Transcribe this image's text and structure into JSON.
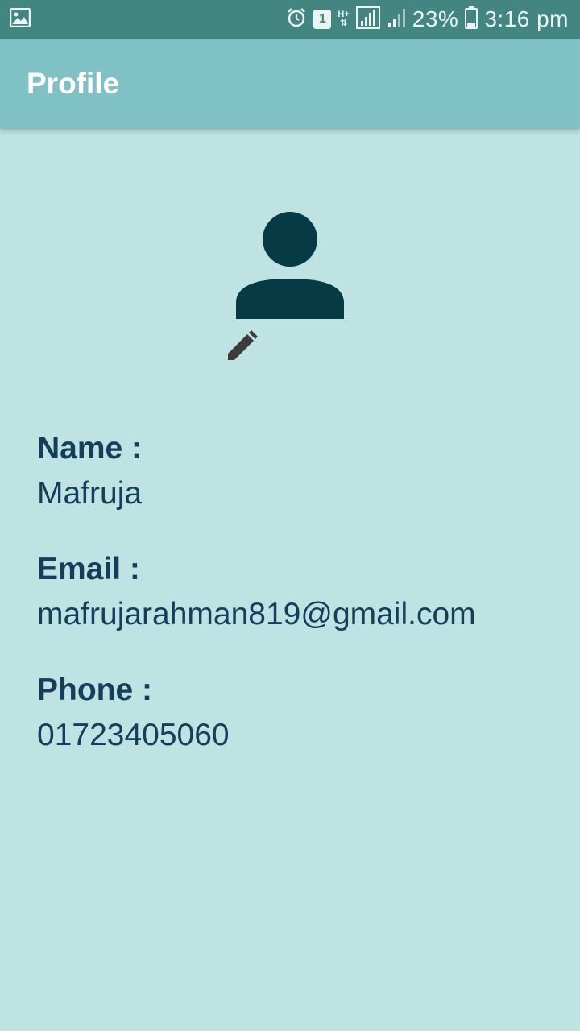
{
  "status_bar": {
    "sim_slot": "1",
    "network_type": "H+",
    "battery_percent": "23%",
    "time": "3:16 pm",
    "icons": [
      "gallery-icon",
      "alarm-icon",
      "sim-icon",
      "network-type-icon",
      "signal-icon",
      "signal-icon",
      "battery-icon"
    ]
  },
  "app_bar": {
    "title": "Profile"
  },
  "profile": {
    "avatar_icon": "person-icon",
    "edit_icon": "pencil-icon",
    "fields": [
      {
        "label": "Name :",
        "value": "Mafruja"
      },
      {
        "label": "Email :",
        "value": "mafrujarahman819@gmail.com"
      },
      {
        "label": "Phone :",
        "value": "01723405060"
      }
    ]
  },
  "colors": {
    "status_bar": "#438581",
    "app_bar": "#80c1c6",
    "background": "#bfe2e3",
    "avatar": "#063a44",
    "text": "#143e59"
  }
}
